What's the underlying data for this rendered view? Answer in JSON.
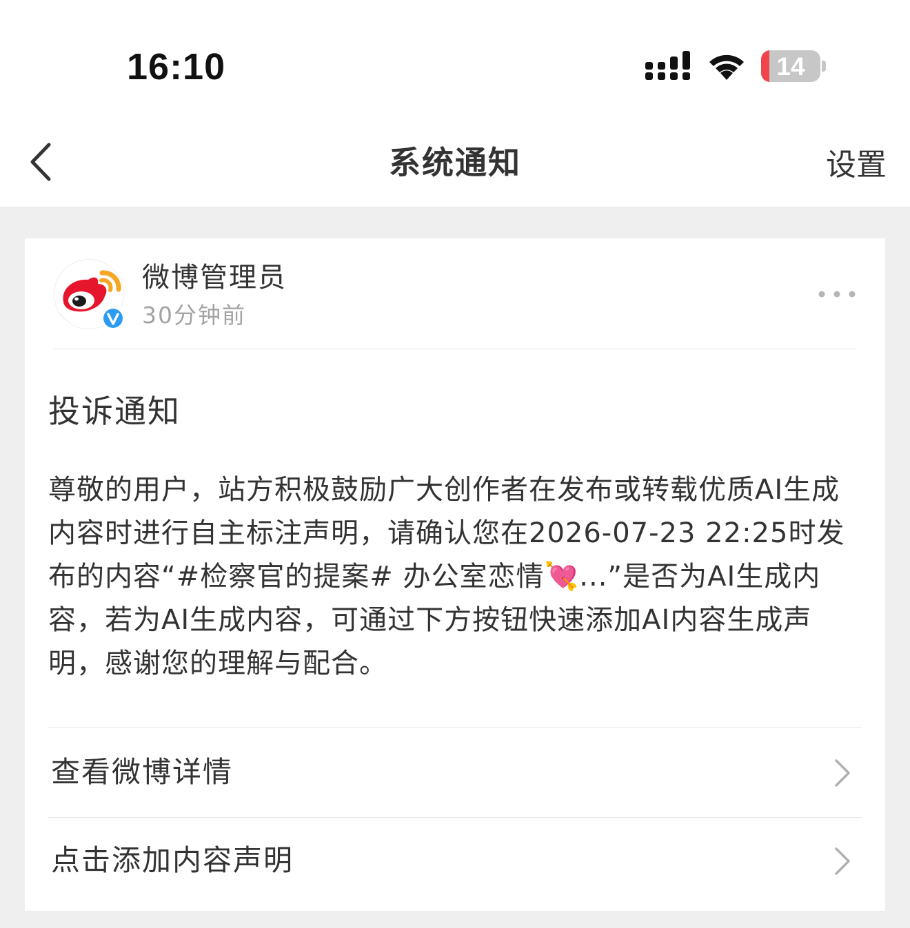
{
  "status_bar": {
    "time": "16:10",
    "battery_level": "14",
    "battery_fraction": 0.14,
    "icons": [
      "signal-icon",
      "wifi-icon",
      "battery-icon"
    ]
  },
  "nav": {
    "title": "系统通知",
    "settings_label": "设置",
    "back_icon": "chevron-left-icon"
  },
  "notification": {
    "sender_name": "微博管理员",
    "sender_time": "30分钟前",
    "avatar_icon": "weibo-logo-icon",
    "verified_icon": "verified-badge-icon",
    "more_icon": "more-dots-icon",
    "title": "投诉通知",
    "body": "尊敬的用户，站方积极鼓励广大创作者在发布或转载优质AI生成内容时进行自主标注声明，请确认您在2026-07-23 22:25时发布的内容“#检察官的提案# 办公室恋情💘...”是否为AI生成内容，若为AI生成内容，可通过下方按钮快速添加AI内容生成声明，感谢您的理解与配合。",
    "actions": [
      {
        "label": "查看微博详情",
        "icon": "chevron-right-icon"
      },
      {
        "label": "点击添加内容声明",
        "icon": "chevron-right-icon"
      }
    ]
  },
  "colors": {
    "page_background": "#efefef",
    "card_background": "#ffffff",
    "primary_text": "#333333",
    "secondary_text": "#a3a3a3",
    "weibo_red": "#e6162d",
    "weibo_orange": "#f5a623",
    "verified_blue": "#2b9cf2",
    "battery_red": "#f0454a"
  }
}
